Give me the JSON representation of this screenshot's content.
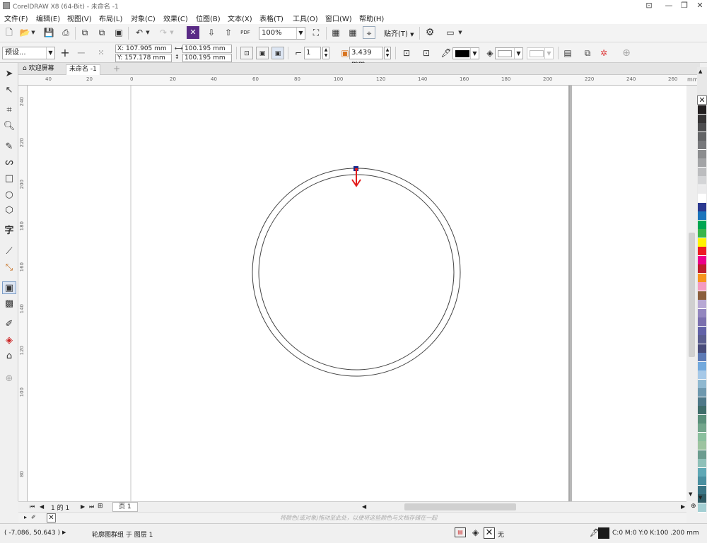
{
  "window": {
    "title": "CorelDRAW X8 (64-Bit) - 未命名 -1"
  },
  "menu": [
    "文件(F)",
    "编辑(E)",
    "视图(V)",
    "布局(L)",
    "对象(C)",
    "效果(C)",
    "位图(B)",
    "文本(X)",
    "表格(T)",
    "工具(O)",
    "窗口(W)",
    "帮助(H)"
  ],
  "standard": {
    "zoom": "100%",
    "snap": "贴齐(T)",
    "pdf": "PDF"
  },
  "property": {
    "preset": "预设...",
    "x": "X: 107.905 mm",
    "y": "Y: 157.178 mm",
    "w": "100.195 mm",
    "h": "100.195 mm",
    "count": "1",
    "offset": "3.439 mm"
  },
  "tabs": {
    "welcome": "欢迎屏幕",
    "doc": "未命名 -1"
  },
  "hruler": [
    "40",
    "20",
    "0",
    "20",
    "40",
    "60",
    "80",
    "100",
    "120",
    "140",
    "160",
    "180",
    "200",
    "220",
    "240",
    "260"
  ],
  "vruler": [
    "240",
    "220",
    "200",
    "180",
    "160",
    "140",
    "120",
    "100",
    "80"
  ],
  "pages": {
    "counter": "1 的 1",
    "page": "页 1"
  },
  "docpal": {
    "hint": "将颜色(或对象)拖动至此处，以便将这些颜色与文档存储在一起"
  },
  "status": {
    "coords": "( -7.086, 50.643 )",
    "info": "轮廓图群组 于 图层 1",
    "fill": "无",
    "outline": "C:0 M:0 Y:0 K:100 .200 mm"
  },
  "palette_colors": [
    "#231f20",
    "#363435",
    "#4d4d4f",
    "#636466",
    "#77787b",
    "#8c8d8f",
    "#a3a4a6",
    "#bcbdbf",
    "#d4d5d7",
    "#ebebec",
    "#ffffff",
    "#2b3990",
    "#1c75bc",
    "#00a651",
    "#39b54a",
    "#fff200",
    "#ed1c24",
    "#ec008c",
    "#be1e2d",
    "#f7941d",
    "#f49ac1",
    "#8b5e3c",
    "#b7a8d4",
    "#9386bf",
    "#7a6fae",
    "#6262a8",
    "#5a5d8f",
    "#484b7a",
    "#5d7ab5",
    "#73a9dd",
    "#a6c9e8",
    "#8fb8d0",
    "#6e98ae",
    "#4e7888",
    "#3f6d6a",
    "#5a8f7a",
    "#72a58b",
    "#8abf9d",
    "#9dc4a0",
    "#6b9c8f",
    "#8ec0b8",
    "#5fa8b5",
    "#4a8fa0",
    "#3a7585",
    "#2e5c66",
    "#a3cfd3"
  ]
}
